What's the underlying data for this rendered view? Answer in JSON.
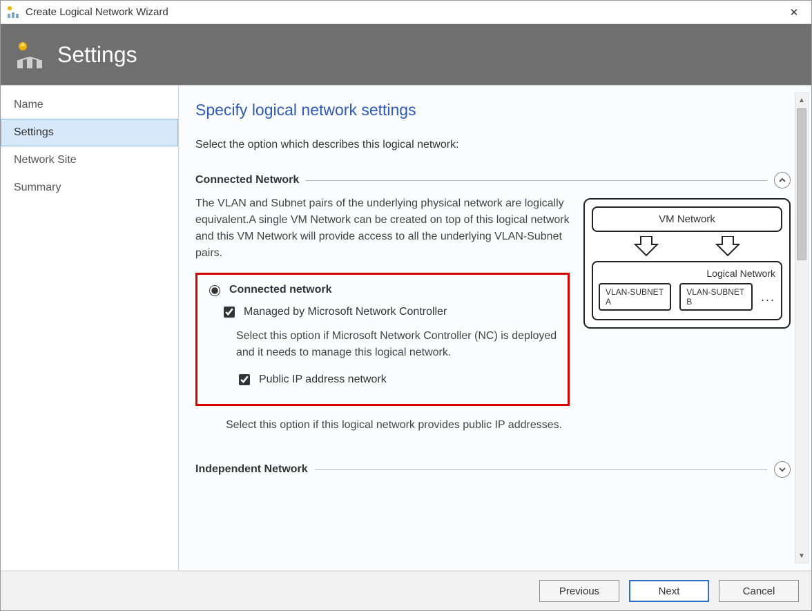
{
  "window": {
    "title": "Create Logical Network Wizard"
  },
  "header": {
    "title": "Settings"
  },
  "sidebar": {
    "items": [
      {
        "label": "Name",
        "selected": false
      },
      {
        "label": "Settings",
        "selected": true
      },
      {
        "label": "Network Site",
        "selected": false
      },
      {
        "label": "Summary",
        "selected": false
      }
    ]
  },
  "content": {
    "page_title": "Specify logical network settings",
    "lead": "Select the option which describes this logical network:",
    "connected": {
      "section_title": "Connected Network",
      "intro": "The VLAN and Subnet pairs of the underlying physical network are logically equivalent.A single VM Network can be created on top of this logical network and this VM Network will provide access to all the underlying VLAN-Subnet pairs.",
      "radio_label": "Connected network",
      "managed_label": "Managed by Microsoft Network Controller",
      "managed_desc": "Select this option if Microsoft Network Controller (NC) is deployed and it needs to manage this logical network.",
      "public_ip_label": "Public IP address network",
      "public_ip_desc": "Select this option if this logical network provides public IP addresses."
    },
    "independent": {
      "section_title": "Independent Network"
    },
    "diagram": {
      "vm_network": "VM Network",
      "logical_label": "Logical  Network",
      "sub_a": "VLAN-SUBNET A",
      "sub_b": "VLAN-SUBNET B",
      "ellipsis": "..."
    }
  },
  "footer": {
    "previous": "Previous",
    "next": "Next",
    "cancel": "Cancel"
  }
}
